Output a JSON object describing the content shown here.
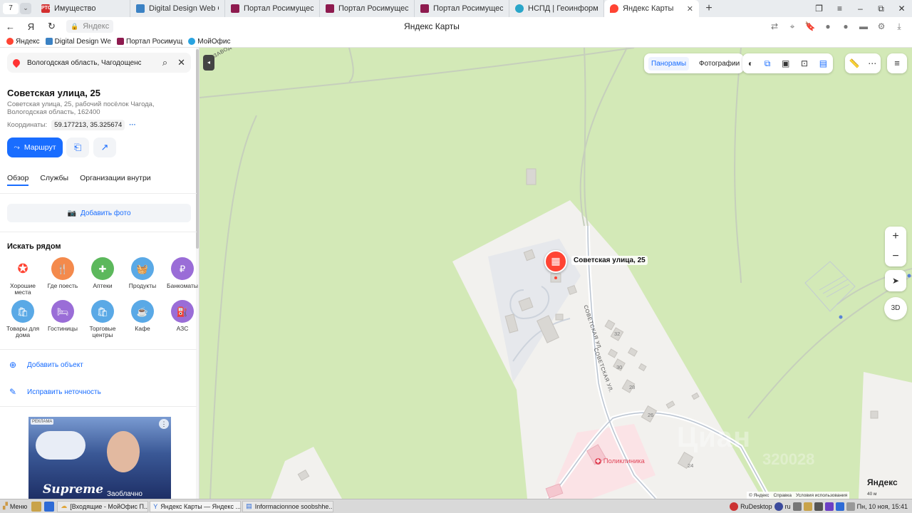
{
  "browser": {
    "tab_counter": "7",
    "tabs": [
      {
        "label": "Имущество",
        "fav_text": "РТС",
        "fav_color": "#d32f2f"
      },
      {
        "label": "Digital Design Web Client",
        "fav_text": "",
        "fav_color": "#3b82c4"
      },
      {
        "label": "Портал Росимущества",
        "fav_text": "",
        "fav_color": "#8e1b4f"
      },
      {
        "label": "Портал Росимущества",
        "fav_text": "",
        "fav_color": "#8e1b4f"
      },
      {
        "label": "Портал Росимущества",
        "fav_text": "",
        "fav_color": "#8e1b4f"
      },
      {
        "label": "НСПД | Геоинформацион",
        "fav_text": "",
        "fav_color": "#2aa6c9"
      },
      {
        "label": "Яндекс Карты",
        "fav_text": "",
        "fav_color": "#f43"
      }
    ],
    "url_text": "Яндекс",
    "page_title": "Яндекс Карты",
    "bookmarks": [
      {
        "label": "Яндекс",
        "color": "#f43"
      },
      {
        "label": "Digital Design We",
        "color": "#3b82c4"
      },
      {
        "label": "Портал Росимущ",
        "color": "#8e1b4f"
      },
      {
        "label": "МойОфис",
        "color": "#29a3e0"
      }
    ]
  },
  "panel": {
    "search_value": "Вологодская область, Чагодощенск",
    "title": "Советская улица, 25",
    "subtitle": "Советская улица, 25, рабочий посёлок Чагода, Вологодская область, 162400",
    "coords_label": "Координаты:",
    "coords_value": "59.177213, 35.325674",
    "route_label": "Маршрут",
    "tabs": [
      "Обзор",
      "Службы",
      "Организации внутри"
    ],
    "add_photo": "Добавить фото",
    "nearby_title": "Искать рядом",
    "categories": [
      {
        "label": "Хорошие места",
        "color": "#ffffff",
        "icon": "★"
      },
      {
        "label": "Где поесть",
        "color": "#f48a4c",
        "icon": "🍴"
      },
      {
        "label": "Аптеки",
        "color": "#5cb85c",
        "icon": "✚"
      },
      {
        "label": "Продукты",
        "color": "#5aa9e6",
        "icon": "🧺"
      },
      {
        "label": "Банкоматы",
        "color": "#9a6dd7",
        "icon": "₽"
      },
      {
        "label": "Товары для дома",
        "color": "#5aa9e6",
        "icon": "🛍"
      },
      {
        "label": "Гостиницы",
        "color": "#9a6dd7",
        "icon": "🛏"
      },
      {
        "label": "Торговые центры",
        "color": "#5aa9e6",
        "icon": "🛍"
      },
      {
        "label": "Кафе",
        "color": "#5aa9e6",
        "icon": "☕"
      },
      {
        "label": "АЗС",
        "color": "#9a6dd7",
        "icon": "⛽"
      }
    ],
    "add_object": "Добавить объект",
    "fix_error": "Исправить неточность",
    "ad_tag": "РЕКЛАМА",
    "ad_brand": "Supreme",
    "ad_slogan": "Заоблачно"
  },
  "map": {
    "toolbar_panoramas": "Панорамы",
    "toolbar_photos": "Фотографии",
    "marker_label": "Советская улица, 25",
    "poi_label": "Поликлиника",
    "houses": [
      "32",
      "30",
      "28",
      "26",
      "24"
    ],
    "street_label": "СОВЕТСКАЯ УЛ.",
    "street_label_2": "СОВЕТСКАЯ УЛ.",
    "street_label_3": "ЗАВОДСКАЯ УЛ.",
    "watermark": "Циан",
    "watermark_2": "320028",
    "btn_3d": "3D",
    "logo": "Яндекс",
    "copyright": [
      "© Яндекс",
      "Справка",
      "Условия использования"
    ],
    "scale": "40 м"
  },
  "taskbar": {
    "menu": "Меню",
    "tasks": [
      "[Входящие - МойОфис П...",
      "Яндекс Карты — Яндекс ...",
      "Informacionnoe soobshhe..."
    ],
    "rudesktop": "RuDesktop",
    "lang": "ru",
    "clock": "Пн, 10 ноя, 15:41"
  },
  "colors": {
    "accent": "#196dff",
    "marker": "#ff4433",
    "map_green": "#d3e9b7"
  }
}
